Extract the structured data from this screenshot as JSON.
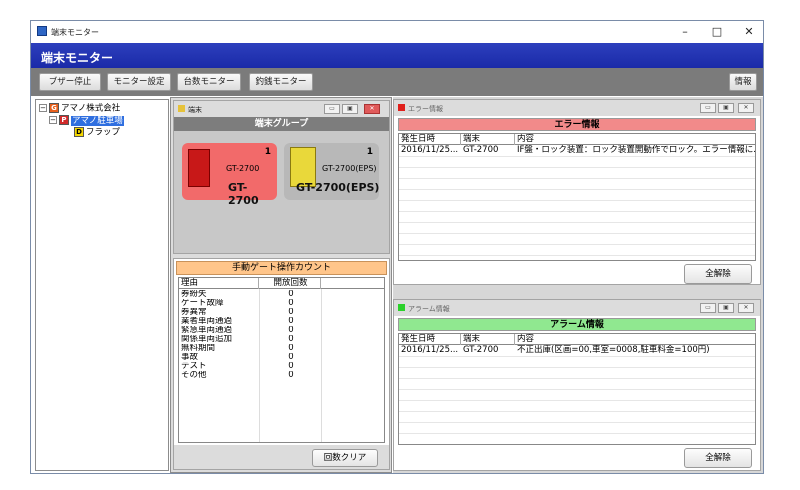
{
  "window": {
    "title": "端末モニター",
    "controls": {
      "minimize": "–",
      "maximize": "□",
      "close": "✕"
    }
  },
  "app_header": {
    "title": "端末モニター"
  },
  "toolbar": {
    "buzzer_stop": "ブザー停止",
    "monitor_settings": "モニター設定",
    "count_monitor": "台数モニター",
    "change_monitor": "釣銭モニター",
    "info": "情報"
  },
  "tree": {
    "company": "アマノ株式会社",
    "parking": "アマノ駐車場",
    "flap": "フラップ",
    "company_icon": "G",
    "parking_icon": "P",
    "flap_icon": "D"
  },
  "terminal_panel": {
    "header": "端末",
    "group_title": "端末グループ",
    "terminals": [
      {
        "count": "1",
        "small_label": "GT-2700",
        "name": "GT-2700",
        "status_color": "#f26a6a"
      },
      {
        "count": "1",
        "small_label": "GT-2700(EPS)",
        "name": "GT-2700(EPS)",
        "status_color": "#b8b8b8"
      }
    ]
  },
  "gate_count": {
    "title": "手動ゲート操作カウント",
    "columns": [
      "理由",
      "開放回数"
    ],
    "rows": [
      {
        "reason": "券紛失",
        "count": "0"
      },
      {
        "reason": "ゲート故障",
        "count": "0"
      },
      {
        "reason": "券異常",
        "count": "0"
      },
      {
        "reason": "業者車両通過",
        "count": "0"
      },
      {
        "reason": "緊急車両通過",
        "count": "0"
      },
      {
        "reason": "関係車両追加",
        "count": "0"
      },
      {
        "reason": "無料期間",
        "count": "0"
      },
      {
        "reason": "事故",
        "count": "0"
      },
      {
        "reason": "テスト",
        "count": "0"
      },
      {
        "reason": "その他",
        "count": "0"
      }
    ],
    "clear_button": "回数クリア"
  },
  "error_panel": {
    "header": "エラー情報",
    "title": "エラー情報",
    "columns": [
      "発生日時",
      "端末",
      "内容"
    ],
    "rows": [
      {
        "date": "2016/11/25...",
        "terminal": "GT-2700",
        "content": "IF盤・ロック装置：ロック装置開動作でロック。エラー情報に..."
      }
    ],
    "clear_all": "全解除",
    "accent": "#f28a8a"
  },
  "alarm_panel": {
    "header": "アラーム情報",
    "title": "アラーム情報",
    "columns": [
      "発生日時",
      "端末",
      "内容"
    ],
    "rows": [
      {
        "date": "2016/11/25...",
        "terminal": "GT-2700",
        "content": "不正出庫(区画=00,車室=0008,駐車料金=100円)"
      }
    ],
    "clear_all": "全解除",
    "accent": "#90e890"
  },
  "pane_controls": {
    "minimize": "▭",
    "restore": "▣",
    "close": "✕"
  }
}
